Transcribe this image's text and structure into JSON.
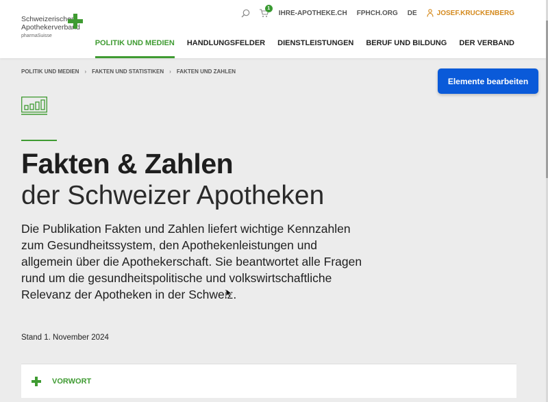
{
  "header": {
    "logo": {
      "line1": "Schweizerischer",
      "line2": "Apothekerverband",
      "line3": "pharmaSuisse"
    },
    "topbar": {
      "cart_count": "1",
      "links": [
        "IHRE-APOTHEKE.CH",
        "FPHCH.ORG",
        "DE"
      ],
      "user": "JOSEF.KRUCKENBERG"
    },
    "nav": [
      {
        "label": "POLITIK UND MEDIEN",
        "active": true
      },
      {
        "label": "HANDLUNGSFELDER"
      },
      {
        "label": "DIENSTLEISTUNGEN"
      },
      {
        "label": "BERUF UND BILDUNG"
      },
      {
        "label": "DER VERBAND"
      }
    ]
  },
  "breadcrumb": [
    "POLITIK UND MEDIEN",
    "FAKTEN UND STATISTIKEN",
    "FAKTEN UND ZAHLEN"
  ],
  "breadcrumb_separator": "›",
  "edit_button": "Elemente bearbeiten",
  "page": {
    "title": "Fakten & Zahlen",
    "subtitle": "der Schweizer Apotheken",
    "lead": "Die Publikation Fakten und Zahlen liefert wichtige Kennzahlen zum Gesundheitssystem, den Apothekenleistungen und allgemein über die Apothekerschaft. Sie beantwortet alle Fragen rund um die gesundheitspolitische und volkswirtschaftliche Relevanz der Apotheken in der Schweiz.",
    "stand": "Stand 1. November 2024"
  },
  "accordion": {
    "label": "VORWORT"
  },
  "colors": {
    "brand_green": "#3f9b32",
    "button_blue": "#0a5ad9",
    "user_orange": "#d4891c"
  }
}
